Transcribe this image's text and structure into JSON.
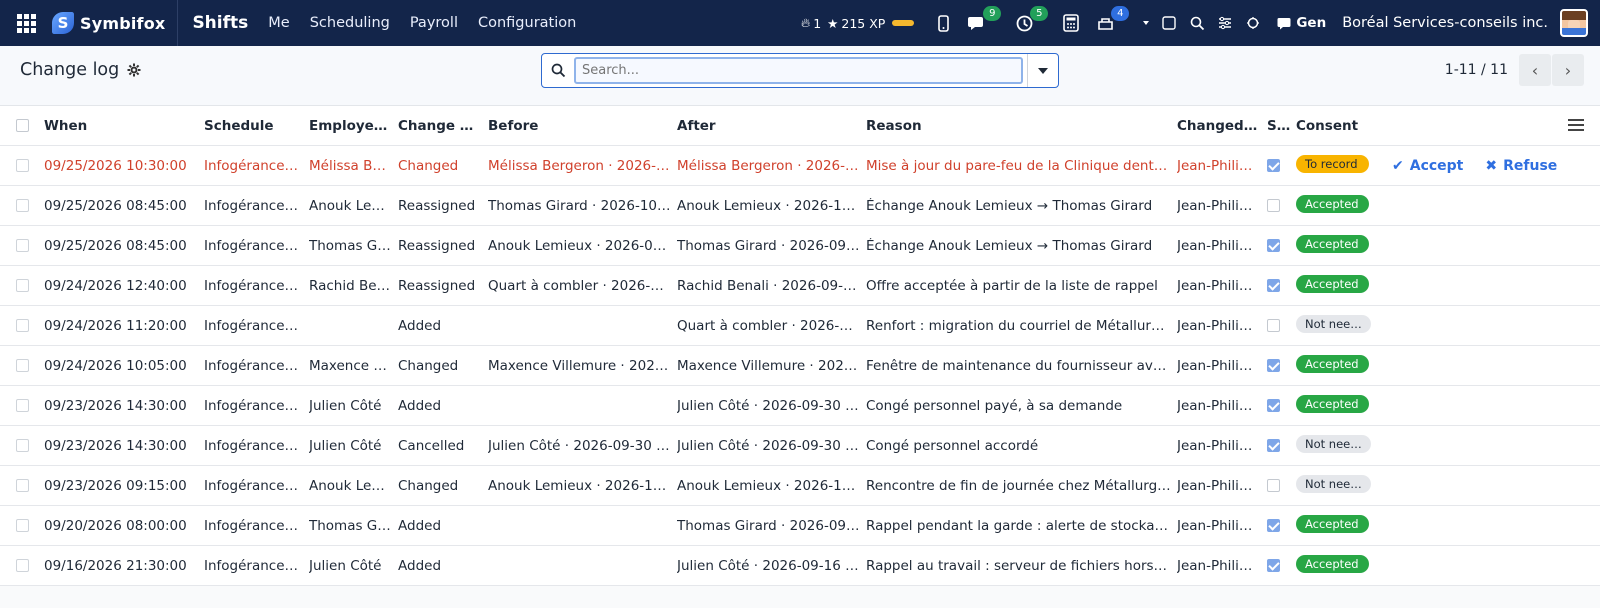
{
  "navbar": {
    "brand": "Symbifox",
    "app_name": "Shifts",
    "menu": [
      "Me",
      "Scheduling",
      "Payroll",
      "Configuration"
    ],
    "streak": "1",
    "xp": "215 XP",
    "chat_badge": "9",
    "activity_badge": "5",
    "notif_badge": "4",
    "gen_label": "Gen",
    "company": "Boréal Services-conseils inc."
  },
  "control": {
    "title": "Change log",
    "search_placeholder": "Search...",
    "pager_range": "1-11 / 11"
  },
  "table": {
    "headers": [
      "When",
      "Schedule",
      "Employe…",
      "Change T…",
      "Before",
      "After",
      "Reason",
      "Changed …",
      "S…",
      "Consent"
    ],
    "rows": [
      {
        "when": "09/25/2026 10:30:00",
        "schedule": "Infogérance…",
        "employee": "Mélissa B…",
        "type": "Changed",
        "before": "Mélissa Bergeron · 2026-…",
        "after": "Mélissa Bergeron · 2026-…",
        "reason": "Mise à jour du pare-feu de la Clinique dent…",
        "changed_by": "Jean-Phili…",
        "consent": "To record",
        "checked": true,
        "status": "record",
        "highlight": true
      },
      {
        "when": "09/25/2026 08:45:00",
        "schedule": "Infogérance…",
        "employee": "Anouk Le…",
        "type": "Reassigned",
        "before": "Thomas Girard · 2026-10…",
        "after": "Anouk Lemieux · 2026-10…",
        "reason": "Échange Anouk Lemieux → Thomas Girard",
        "changed_by": "Jean-Phili…",
        "consent": "Accepted",
        "checked": false,
        "status": "accepted",
        "highlight": false
      },
      {
        "when": "09/25/2026 08:45:00",
        "schedule": "Infogérance…",
        "employee": "Thomas G…",
        "type": "Reassigned",
        "before": "Anouk Lemieux · 2026-09…",
        "after": "Thomas Girard · 2026-09…",
        "reason": "Échange Anouk Lemieux → Thomas Girard",
        "changed_by": "Jean-Phili…",
        "consent": "Accepted",
        "checked": true,
        "status": "accepted",
        "highlight": false
      },
      {
        "when": "09/24/2026 12:40:00",
        "schedule": "Infogérance…",
        "employee": "Rachid Be…",
        "type": "Reassigned",
        "before": "Quart à combler · 2026-0…",
        "after": "Rachid Benali · 2026-09-…",
        "reason": "Offre acceptée à partir de la liste de rappel",
        "changed_by": "Jean-Phili…",
        "consent": "Accepted",
        "checked": true,
        "status": "accepted",
        "highlight": false
      },
      {
        "when": "09/24/2026 11:20:00",
        "schedule": "Infogérance…",
        "employee": "",
        "type": "Added",
        "before": "",
        "after": "Quart à combler · 2026-…",
        "reason": "Renfort : migration du courriel de Métallur…",
        "changed_by": "Jean-Phili…",
        "consent": "Not nee…",
        "checked": false,
        "status": "notneeded",
        "highlight": false
      },
      {
        "when": "09/24/2026 10:05:00",
        "schedule": "Infogérance…",
        "employee": "Maxence …",
        "type": "Changed",
        "before": "Maxence Villemure · 202…",
        "after": "Maxence Villemure · 202…",
        "reason": "Fenêtre de maintenance du fournisseur av…",
        "changed_by": "Jean-Phili…",
        "consent": "Accepted",
        "checked": true,
        "status": "accepted",
        "highlight": false
      },
      {
        "when": "09/23/2026 14:30:00",
        "schedule": "Infogérance…",
        "employee": "Julien Côté",
        "type": "Added",
        "before": "",
        "after": "Julien Côté · 2026-09-30 …",
        "reason": "Congé personnel payé, à sa demande",
        "changed_by": "Jean-Phili…",
        "consent": "Accepted",
        "checked": true,
        "status": "accepted",
        "highlight": false
      },
      {
        "when": "09/23/2026 14:30:00",
        "schedule": "Infogérance…",
        "employee": "Julien Côté",
        "type": "Cancelled",
        "before": "Julien Côté · 2026-09-30 …",
        "after": "Julien Côté · 2026-09-30 …",
        "reason": "Congé personnel accordé",
        "changed_by": "Jean-Phili…",
        "consent": "Not nee…",
        "checked": true,
        "status": "notneeded",
        "highlight": false
      },
      {
        "when": "09/23/2026 09:15:00",
        "schedule": "Infogérance…",
        "employee": "Anouk Le…",
        "type": "Changed",
        "before": "Anouk Lemieux · 2026-10…",
        "after": "Anouk Lemieux · 2026-10…",
        "reason": "Rencontre de fin de journée chez Métallurg…",
        "changed_by": "Jean-Phili…",
        "consent": "Not nee…",
        "checked": false,
        "status": "notneeded",
        "highlight": false
      },
      {
        "when": "09/20/2026 08:00:00",
        "schedule": "Infogérance…",
        "employee": "Thomas G…",
        "type": "Added",
        "before": "",
        "after": "Thomas Girard · 2026-09…",
        "reason": "Rappel pendant la garde : alerte de stocka…",
        "changed_by": "Jean-Phili…",
        "consent": "Accepted",
        "checked": true,
        "status": "accepted",
        "highlight": false
      },
      {
        "when": "09/16/2026 21:30:00",
        "schedule": "Infogérance…",
        "employee": "Julien Côté",
        "type": "Added",
        "before": "",
        "after": "Julien Côté · 2026-09-16 …",
        "reason": "Rappel au travail : serveur de fichiers hors…",
        "changed_by": "Jean-Phili…",
        "consent": "Accepted",
        "checked": true,
        "status": "accepted",
        "highlight": false
      }
    ],
    "row_actions": {
      "accept": "Accept",
      "refuse": "Refuse"
    }
  },
  "colors": {
    "navbar_bg": "#13254a",
    "accent": "#2f6fe0",
    "highlight_text": "#d0412c",
    "accepted": "#28a745",
    "to_record": "#f8b400"
  }
}
